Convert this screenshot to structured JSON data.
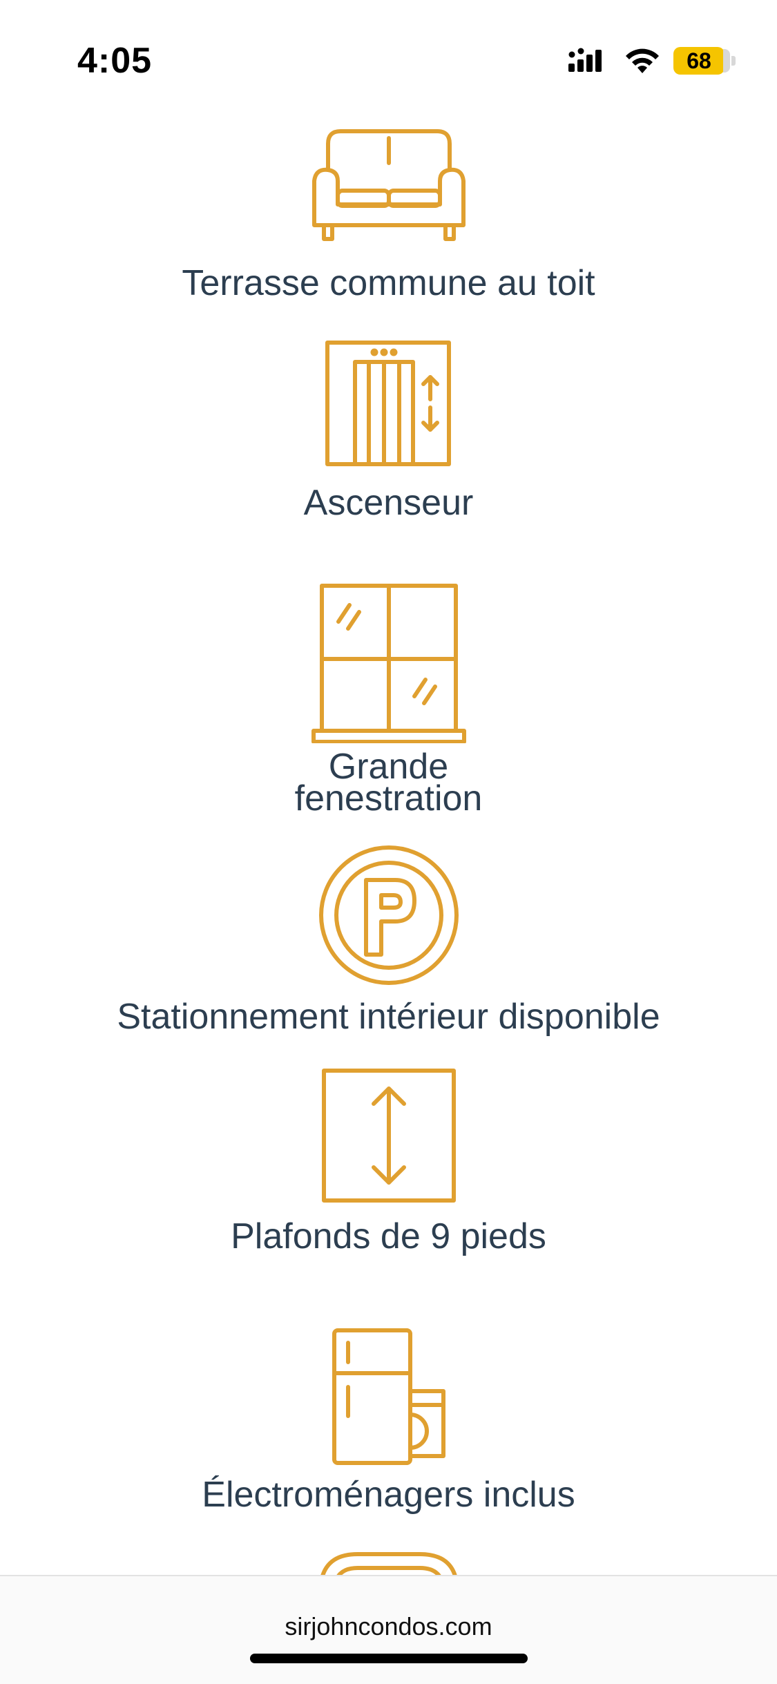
{
  "status_bar": {
    "time": "4:05",
    "battery": "68",
    "icons": [
      "cellular-signal-icon",
      "wifi-icon",
      "battery-icon"
    ],
    "battery_color": "#f5c400"
  },
  "accent_color": "#e0a030",
  "features": [
    {
      "icon": "sofa-icon",
      "label": "Terrasse commune au toit"
    },
    {
      "icon": "elevator-icon",
      "label": "Ascenseur"
    },
    {
      "icon": "window-icon",
      "label_line1": "Grande",
      "label_line2": "fenestration"
    },
    {
      "icon": "parking-icon",
      "label": "Stationnement intérieur disponible"
    },
    {
      "icon": "ceiling-height-icon",
      "label": "Plafonds de 9 pieds"
    },
    {
      "icon": "appliances-icon",
      "label": "Électroménagers inclus"
    },
    {
      "icon": "partial-icon"
    }
  ],
  "footer": {
    "url": "sirjohncondos.com"
  }
}
